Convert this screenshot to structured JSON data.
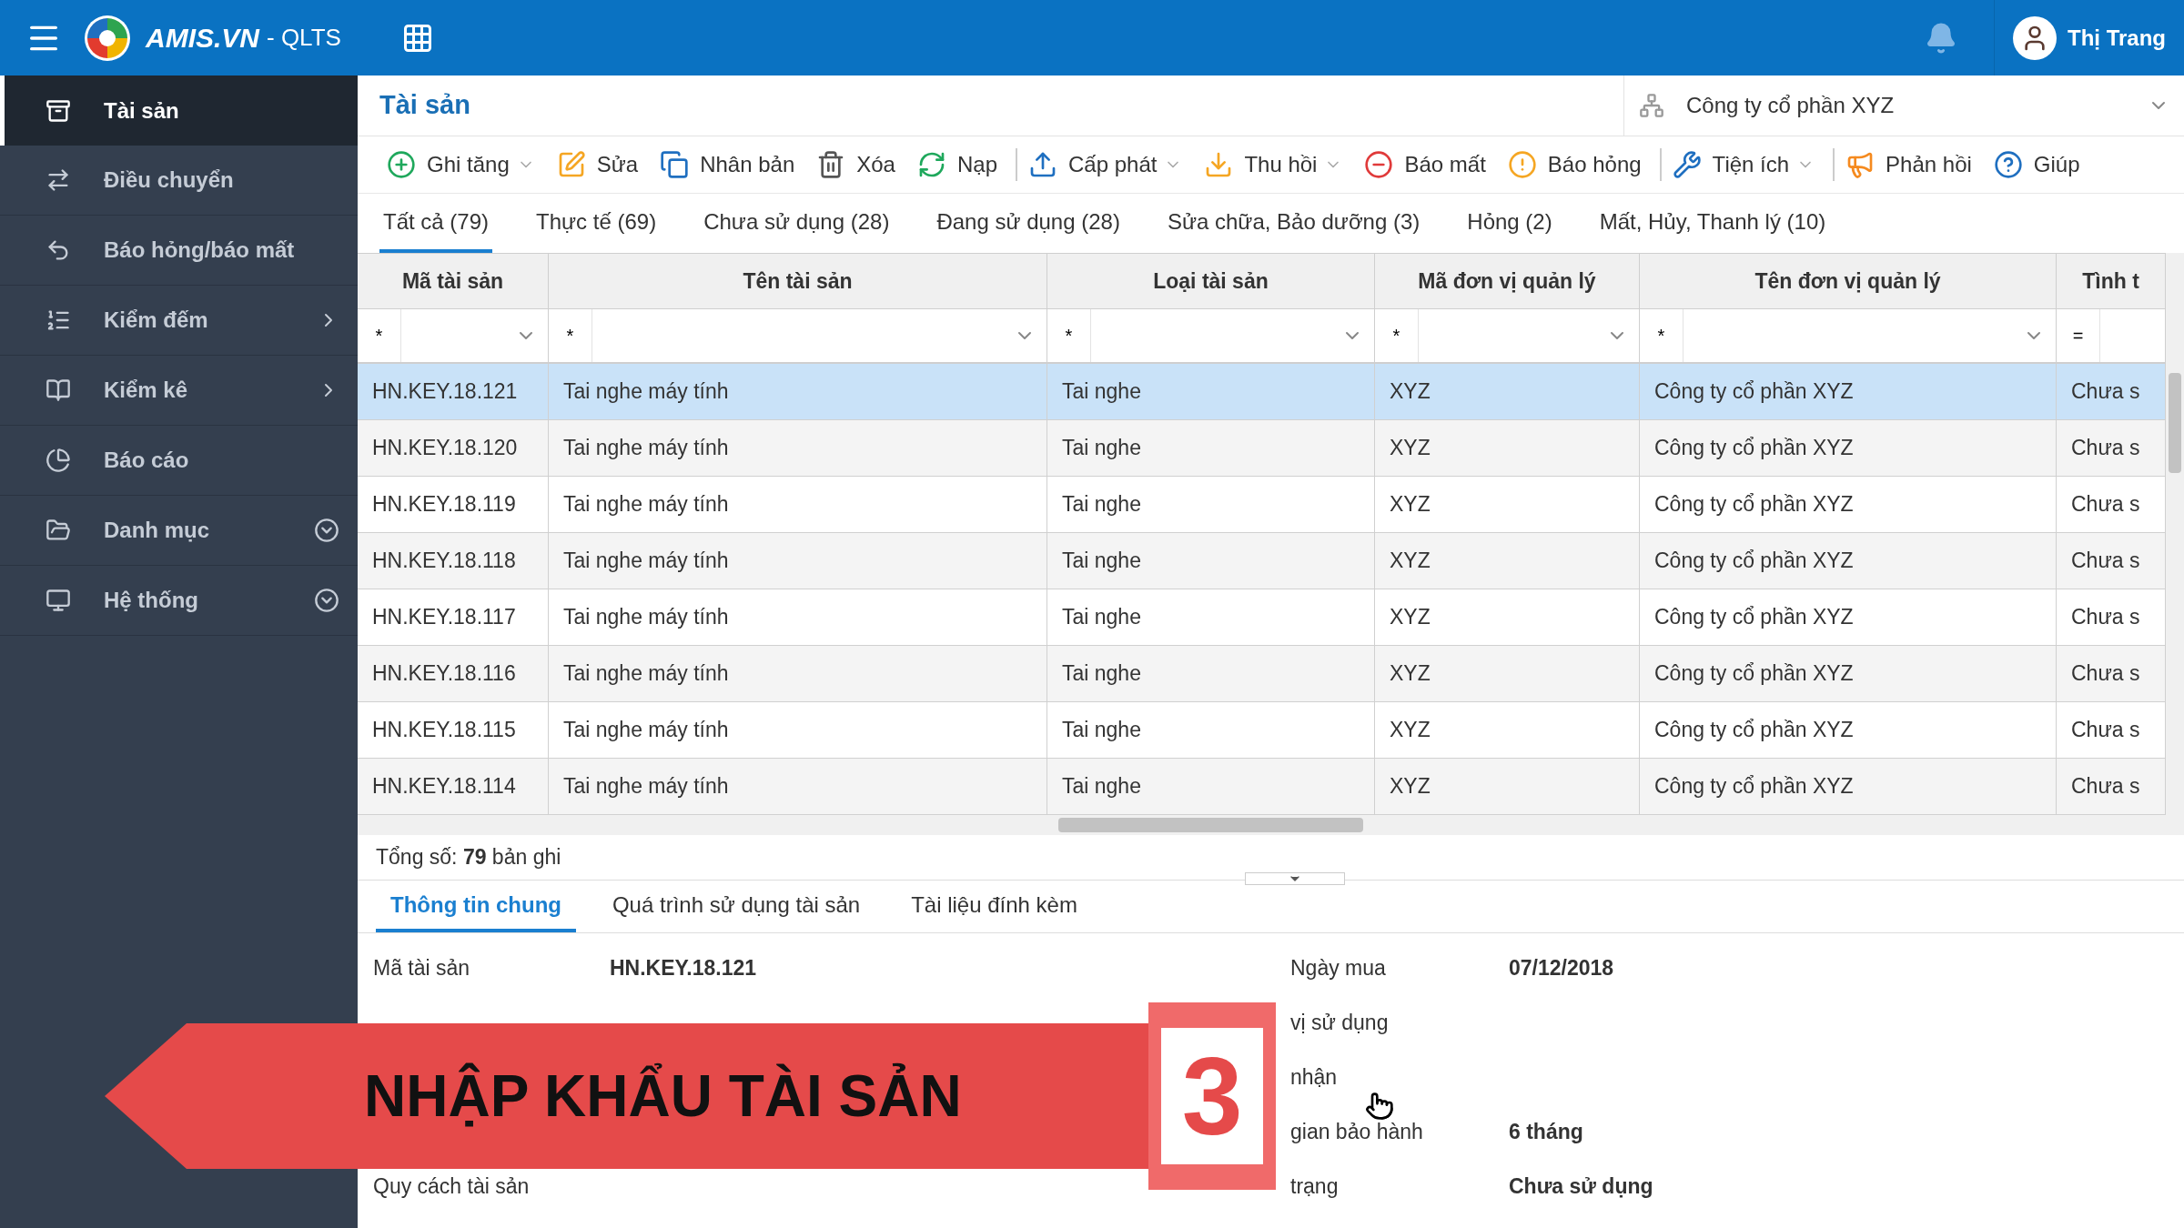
{
  "topbar": {
    "brand": "AMIS.VN",
    "product": "- QLTS",
    "user": "Thị Trang"
  },
  "sidebar": [
    {
      "label": "Tài sản",
      "selected": true,
      "kind": "plain"
    },
    {
      "label": "Điều chuyển",
      "selected": false,
      "kind": "plain"
    },
    {
      "label": "Báo hỏng/báo mất",
      "selected": false,
      "kind": "plain"
    },
    {
      "label": "Kiểm đếm",
      "selected": false,
      "kind": "submenu"
    },
    {
      "label": "Kiểm kê",
      "selected": false,
      "kind": "submenu"
    },
    {
      "label": "Báo cáo",
      "selected": false,
      "kind": "plain"
    },
    {
      "label": "Danh mục",
      "selected": false,
      "kind": "expandable"
    },
    {
      "label": "Hệ thống",
      "selected": false,
      "kind": "expandable"
    }
  ],
  "page_title": "Tài sản",
  "company": "Công ty cổ phần XYZ",
  "toolbar": [
    {
      "label": "Ghi tăng",
      "dropdown": true
    },
    {
      "label": "Sửa",
      "dropdown": false
    },
    {
      "label": "Nhân bản",
      "dropdown": false
    },
    {
      "label": "Xóa",
      "dropdown": false
    },
    {
      "label": "Nạp",
      "dropdown": false
    },
    {
      "label": "Cấp phát",
      "dropdown": true,
      "separator_before": true
    },
    {
      "label": "Thu hồi",
      "dropdown": true
    },
    {
      "label": "Báo mất",
      "dropdown": false
    },
    {
      "label": "Báo hỏng",
      "dropdown": false
    },
    {
      "label": "Tiện ích",
      "dropdown": true,
      "separator_before": true
    },
    {
      "label": "Phản hồi",
      "dropdown": false,
      "separator_before": true
    },
    {
      "label": "Giúp",
      "dropdown": false
    }
  ],
  "tabs": [
    {
      "label": "Tất cả (79)",
      "selected": true
    },
    {
      "label": "Thực tế (69)",
      "selected": false
    },
    {
      "label": "Chưa sử dụng (28)",
      "selected": false
    },
    {
      "label": "Đang sử dụng (28)",
      "selected": false
    },
    {
      "label": "Sửa chữa, Bảo dưỡng (3)",
      "selected": false
    },
    {
      "label": "Hỏng (2)",
      "selected": false
    },
    {
      "label": "Mất, Hủy, Thanh lý (10)",
      "selected": false
    }
  ],
  "table": {
    "columns": [
      "Mã tài sản",
      "Tên tài sản",
      "Loại tài sản",
      "Mã đơn vị quản lý",
      "Tên đơn vị quản lý",
      "Tình t"
    ],
    "filters": [
      "*",
      "*",
      "*",
      "*",
      "*",
      "="
    ],
    "rows": [
      {
        "selected": true,
        "cells": [
          "HN.KEY.18.121",
          "Tai nghe máy tính",
          "Tai nghe",
          "XYZ",
          "Công ty cổ phần XYZ",
          "Chưa s"
        ]
      },
      {
        "selected": false,
        "cells": [
          "HN.KEY.18.120",
          "Tai nghe máy tính",
          "Tai nghe",
          "XYZ",
          "Công ty cổ phần XYZ",
          "Chưa s"
        ]
      },
      {
        "selected": false,
        "cells": [
          "HN.KEY.18.119",
          "Tai nghe máy tính",
          "Tai nghe",
          "XYZ",
          "Công ty cổ phần XYZ",
          "Chưa s"
        ]
      },
      {
        "selected": false,
        "cells": [
          "HN.KEY.18.118",
          "Tai nghe máy tính",
          "Tai nghe",
          "XYZ",
          "Công ty cổ phần XYZ",
          "Chưa s"
        ]
      },
      {
        "selected": false,
        "cells": [
          "HN.KEY.18.117",
          "Tai nghe máy tính",
          "Tai nghe",
          "XYZ",
          "Công ty cổ phần XYZ",
          "Chưa s"
        ]
      },
      {
        "selected": false,
        "cells": [
          "HN.KEY.18.116",
          "Tai nghe máy tính",
          "Tai nghe",
          "XYZ",
          "Công ty cổ phần XYZ",
          "Chưa s"
        ]
      },
      {
        "selected": false,
        "cells": [
          "HN.KEY.18.115",
          "Tai nghe máy tính",
          "Tai nghe",
          "XYZ",
          "Công ty cổ phần XYZ",
          "Chưa s"
        ]
      },
      {
        "selected": false,
        "cells": [
          "HN.KEY.18.114",
          "Tai nghe máy tính",
          "Tai nghe",
          "XYZ",
          "Công ty cổ phần XYZ",
          "Chưa s"
        ]
      }
    ],
    "total": "Tổng số: **79** bản ghi"
  },
  "detail_tabs": [
    {
      "label": "Thông tin chung",
      "selected": true
    },
    {
      "label": "Quá trình sử dụng tài sản",
      "selected": false
    },
    {
      "label": "Tài liệu đính kèm",
      "selected": false
    }
  ],
  "details": [
    {
      "left": {
        "label": "Mã tài sản",
        "value": "HN.KEY.18.121"
      },
      "right": {
        "label": "Ngày mua",
        "value": "07/12/2018"
      }
    },
    {
      "right": {
        "label": "vị sử dụng"
      }
    },
    {
      "right": {
        "label": "nhận"
      }
    },
    {
      "right": {
        "label": "gian bảo hành",
        "value": "6 tháng"
      }
    },
    {
      "left": {
        "label": "Quy cách tài sản"
      },
      "right": {
        "label": "trạng",
        "value": "Chưa sử dụng"
      }
    }
  ],
  "banner": {
    "title": "NHẬP KHẨU TÀI SẢN",
    "number": "3"
  }
}
